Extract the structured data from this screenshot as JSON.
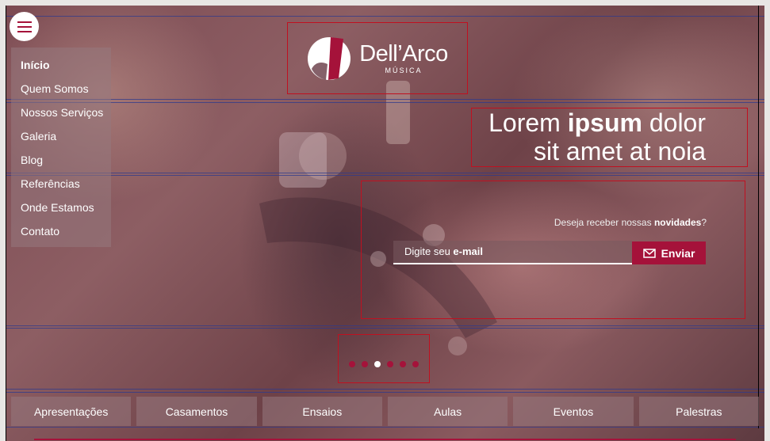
{
  "menu": {
    "items": [
      {
        "label": "Início",
        "active": true
      },
      {
        "label": "Quem Somos"
      },
      {
        "label": "Nossos Serviços"
      },
      {
        "label": "Galeria"
      },
      {
        "label": "Blog"
      },
      {
        "label": "Referências"
      },
      {
        "label": "Onde Estamos"
      },
      {
        "label": "Contato"
      }
    ]
  },
  "logo": {
    "brand": "Dell’Arco",
    "sub": "MÚSICA"
  },
  "hero": {
    "line1_pre": "Lorem ",
    "line1_bold": "ipsum",
    "line1_post": " dolor",
    "line2": "sit amet at noia"
  },
  "newsletter": {
    "question_pre": "Deseja receber nossas ",
    "question_bold": "novidades",
    "question_post": "?",
    "placeholder_pre": "Digite seu ",
    "placeholder_bold": "e-mail",
    "button_label": "Enviar"
  },
  "slider": {
    "count": 6,
    "active_index": 2
  },
  "categories": [
    "Apresentações",
    "Casamentos",
    "Ensaios",
    "Aulas",
    "Eventos",
    "Palestras"
  ],
  "colors": {
    "accent": "#a5123a",
    "overlay": "#7b4a52"
  }
}
